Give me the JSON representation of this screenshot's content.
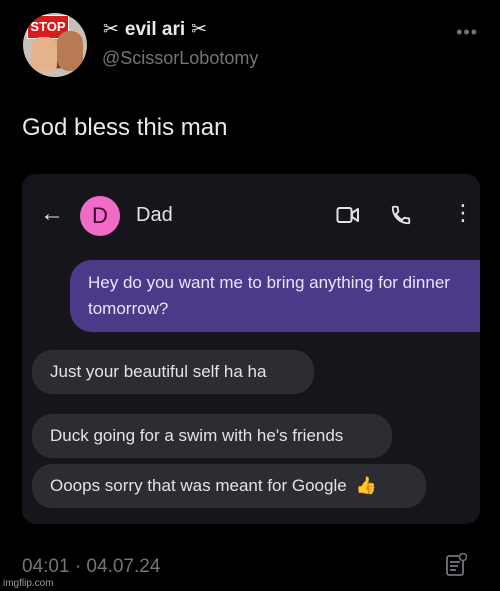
{
  "tweet": {
    "display_name": "evil ari",
    "name_emoji": "✂",
    "handle": "@ScissorLobotomy",
    "avatar_sign_text": "STOP",
    "more_icon": "more-horizontal-icon",
    "text": "God bless this man",
    "timestamp": "04:01 · 04.07.24",
    "analytics_icon": "analytics-icon"
  },
  "screenshot": {
    "contact_initial": "D",
    "contact_name": "Dad",
    "contact_color": "#f06cc8",
    "messages": [
      {
        "direction": "sent",
        "text": "Hey do you want me to bring anything for dinner tomorrow?"
      },
      {
        "direction": "received",
        "text": "Just your beautiful self ha ha"
      },
      {
        "direction": "received",
        "text": "Duck going for a swim with he's friends"
      },
      {
        "direction": "received",
        "text": "Ooops sorry that was meant for Google",
        "emoji": "👍"
      }
    ]
  },
  "watermark": "imgflip.com",
  "colors": {
    "background": "#000000",
    "sent_bubble": "#4b3a88",
    "received_bubble": "#2e2c33",
    "muted": "#71767b"
  }
}
